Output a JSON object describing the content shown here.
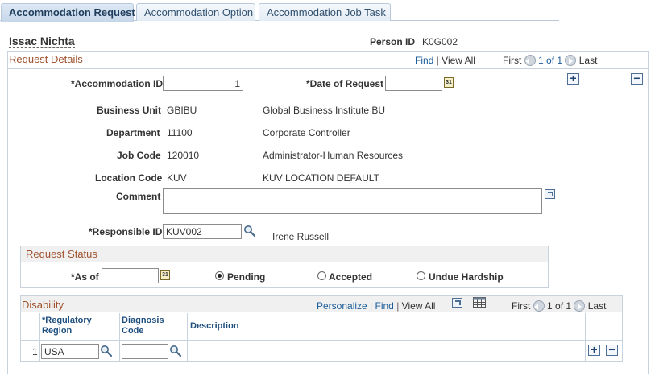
{
  "tabs": [
    {
      "label": "Accommodation Request",
      "active": true
    },
    {
      "label": "Accommodation Option",
      "active": false
    },
    {
      "label": "Accommodation Job Task",
      "active": false
    }
  ],
  "person": {
    "name": "Issac Nichta",
    "id_label": "Person ID",
    "id_value": "K0G002"
  },
  "request_details": {
    "title": "Request Details",
    "nav": {
      "find": "Find",
      "sep": "|",
      "view_all": "View All",
      "first": "First",
      "count": "1 of 1",
      "last": "Last"
    },
    "accommodation_id": {
      "label": "*Accommodation ID",
      "value": "1"
    },
    "date_of_request": {
      "label": "*Date of Request",
      "value": ""
    },
    "business_unit": {
      "label": "Business Unit",
      "code": "GBIBU",
      "desc": "Global Business Institute BU"
    },
    "department": {
      "label": "Department",
      "code": "11100",
      "desc": "Corporate Controller"
    },
    "job_code": {
      "label": "Job Code",
      "code": "120010",
      "desc": "Administrator-Human Resources"
    },
    "location_code": {
      "label": "Location Code",
      "code": "KUV",
      "desc": "KUV LOCATION DEFAULT"
    },
    "comment": {
      "label": "Comment",
      "value": ""
    },
    "responsible_id": {
      "label": "*Responsible ID",
      "value": "KUV002",
      "name": "Irene Russell"
    }
  },
  "request_status": {
    "title": "Request Status",
    "as_of": {
      "label": "*As of",
      "value": ""
    },
    "options": [
      {
        "label": "Pending",
        "selected": true
      },
      {
        "label": "Accepted",
        "selected": false
      },
      {
        "label": "Undue Hardship",
        "selected": false
      }
    ]
  },
  "disability": {
    "title": "Disability",
    "nav": {
      "personalize": "Personalize",
      "sep": "|",
      "find": "Find",
      "view_all": "View All",
      "first": "First",
      "count": "1 of 1",
      "last": "Last"
    },
    "columns": {
      "regulatory_region": "*Regulatory\nRegion",
      "diagnosis_code": "Diagnosis\nCode",
      "description": "Description"
    },
    "rows": [
      {
        "num": "1",
        "regulatory_region": "USA",
        "diagnosis_code": "",
        "description": ""
      }
    ]
  },
  "buttons": {
    "add": "+",
    "delete": "−",
    "calendar": "31"
  },
  "colors": {
    "section_title": "#a0522d",
    "link": "#1b5c9a",
    "tab_active_bg": "#c6d7ea"
  }
}
